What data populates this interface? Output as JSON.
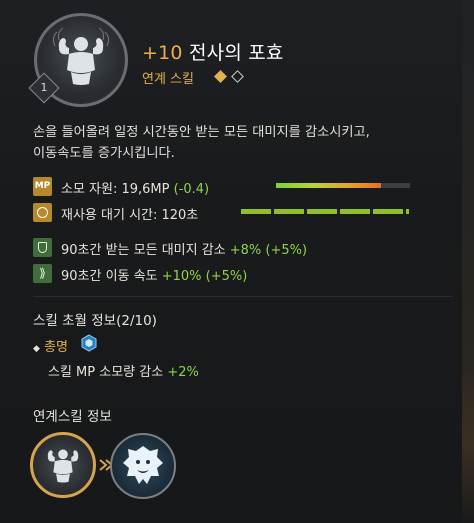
{
  "header": {
    "level_prefix": "+10",
    "skill_name": "전사의 포효",
    "category": "연계 스킬",
    "level_badge": "1",
    "icon": "flexing-warrior-icon"
  },
  "description": {
    "line1": "손을 들어올려 일정 시간동안 받는 모든 대미지를 감소시키고,",
    "line2": "이동속도를 증가시킵니다."
  },
  "stats": {
    "mp_icon_text": "MP",
    "mp_label": "소모 자원: 19,6MP ",
    "mp_change": "(-0.4)",
    "mp_bar_fill": 0.78,
    "cooldown_label": "재사용 대기 시간: 120초",
    "cooldown_bar_fill": 1.0,
    "effect1_label": "90초간 받는 모든 대미지 감소 ",
    "effect1_value": "+8% (+5%)",
    "effect2_label": "90초간 이동 속도 ",
    "effect2_value": "+10% (+5%)"
  },
  "transcendence": {
    "title": "스킬 초월 정보(2/10)",
    "bullet": "◆",
    "grade": "총명",
    "effect": "스킬 MP 소모량 감소 ",
    "effect_value": "+2%"
  },
  "combo": {
    "title": "연계스킬 정보",
    "skill1_icon": "flexing-warrior-icon",
    "skill2_icon": "roaring-lion-icon"
  },
  "colors": {
    "accent_gold": "#e2b24a",
    "positive_green": "#8fd44a"
  }
}
